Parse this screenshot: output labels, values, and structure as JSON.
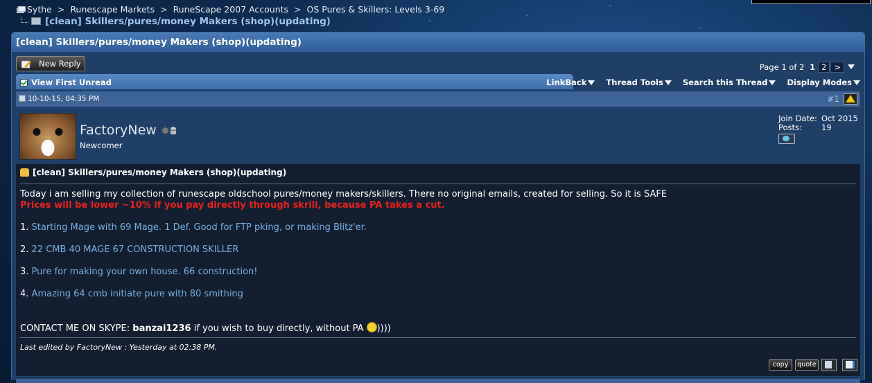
{
  "breadcrumbs": [
    "Sythe",
    "Runescape Markets",
    "RuneScape 2007 Accounts",
    "OS Pures & Skillers: Levels 3-69"
  ],
  "breadcrumb_sep": ">",
  "thread_crumb": "[clean] Skillers/pures/money Makers (shop)(updating)",
  "panel_title": "[clean] Skillers/pures/money Makers (shop)(updating)",
  "toolbar": {
    "new_reply": "New Reply"
  },
  "pagination": {
    "label": "Page 1 of 2",
    "current": "1",
    "next_page": "2",
    "next": ">"
  },
  "tabs": {
    "view_first_unread": "View First Unread",
    "linkback": "LinkBack",
    "thread_tools": "Thread Tools",
    "search_thread": "Search this Thread",
    "display_modes": "Display Modes"
  },
  "post": {
    "date": "10-10-15, 04:35 PM",
    "number": "#1",
    "username": "FactoryNew",
    "rank": "Newcomer",
    "join_label": "Join Date:",
    "join_value": "Oct 2015",
    "posts_label": "Posts:",
    "posts_value": "19",
    "title": "[clean] Skillers/pures/money Makers (shop)(updating)",
    "intro": "Today i am selling my collection of runescape oldschool pures/money makers/skillers. There no original emails, created for selling. So it is SAFE",
    "price_note": "Prices will be lower ~10% if you pay directly through skrill, because PA takes a cut.",
    "items": [
      {
        "num": "1.",
        "text": "Starting Mage with 69 Mage. 1 Def. Good for FTP pking, or making Blitz'er."
      },
      {
        "num": "2.",
        "text": "22 CMB 40 MAGE 67 CONSTRUCTION SKILLER"
      },
      {
        "num": "3.",
        "text": "Pure for making your own house. 66 construction!"
      },
      {
        "num": "4.",
        "text": "Amazing 64 cmb initiate pure with 80 smithing"
      }
    ],
    "contact_prefix": "CONTACT ME ON SKYPE: ",
    "contact_skype": "banzai1236",
    "contact_suffix": " if you wish to buy directly, without PA",
    "contact_tail": "))))",
    "edited": "Last edited by FactoryNew : Yesterday at 02:38 PM.",
    "copy_label": "copy",
    "quote_label": "quote"
  },
  "colors": {
    "accent_red": "#e8211c",
    "link_blue": "#74aee6",
    "header_blue": "#3e6496"
  }
}
